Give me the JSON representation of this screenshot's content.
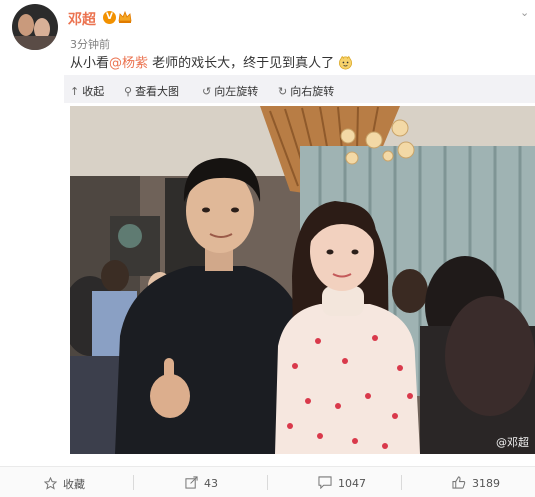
{
  "post": {
    "author": "邓超",
    "verified_badge": "V",
    "time": "3分钟前",
    "text_before": "从小看",
    "mention": "@杨紫",
    "text_after": " 老师的戏长大，终于见到真人了"
  },
  "image_toolbar": {
    "collapse": "收起",
    "view_large": "查看大图",
    "rotate_left": "向左旋转",
    "rotate_right": "向右旋转"
  },
  "photo": {
    "watermark": "@邓超"
  },
  "footer": {
    "favorite": "收藏",
    "repost_count": "43",
    "comment_count": "1047",
    "like_count": "3189"
  },
  "colors": {
    "accent": "#eb7350",
    "verified": "#f29100",
    "toolbar_bg": "#f2f2f5"
  }
}
